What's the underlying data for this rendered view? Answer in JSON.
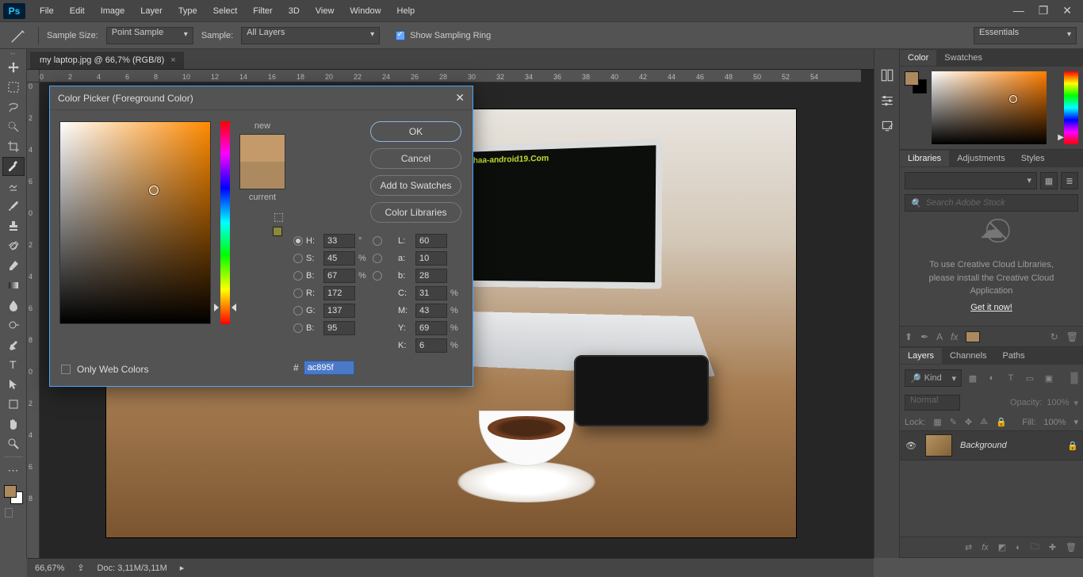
{
  "menu": [
    "File",
    "Edit",
    "Image",
    "Layer",
    "Type",
    "Select",
    "Filter",
    "3D",
    "View",
    "Window",
    "Help"
  ],
  "options": {
    "sample_size_label": "Sample Size:",
    "sample_size_value": "Point Sample",
    "sample_label": "Sample:",
    "sample_value": "All Layers",
    "show_ring": "Show Sampling Ring",
    "workspace": "Essentials"
  },
  "document": {
    "tab_title": "my laptop.jpg @ 66,7% (RGB/8)",
    "watermark": "kuyhaa-android19"
  },
  "ruler_h": [
    "0",
    "2",
    "4",
    "6",
    "8",
    "10",
    "12",
    "14",
    "16",
    "18",
    "20",
    "22",
    "24",
    "26",
    "28",
    "30",
    "32",
    "34",
    "36",
    "38",
    "40",
    "42",
    "44",
    "46",
    "48",
    "50",
    "52",
    "54"
  ],
  "ruler_v": [
    "0",
    "2",
    "4",
    "6",
    "0",
    "2",
    "4",
    "6",
    "8",
    "0",
    "2",
    "4",
    "6",
    "8"
  ],
  "status": {
    "zoom": "66,67%",
    "doc": "Doc: 3,11M/3,11M"
  },
  "panels": {
    "color_tabs": [
      "Color",
      "Swatches"
    ],
    "mid_tabs": [
      "Libraries",
      "Adjustments",
      "Styles"
    ],
    "lib_search": "Search Adobe Stock",
    "lib_msg": "To use Creative Cloud Libraries, please install the Creative Cloud Application",
    "lib_link": "Get it now!",
    "layer_tabs": [
      "Layers",
      "Channels",
      "Paths"
    ],
    "kind": "Kind",
    "blend": "Normal",
    "opacity_lbl": "Opacity:",
    "opacity_val": "100%",
    "lock_lbl": "Lock:",
    "fill_lbl": "Fill:",
    "fill_val": "100%",
    "layer_name": "Background"
  },
  "picker": {
    "title": "Color Picker (Foreground Color)",
    "new_lbl": "new",
    "current_lbl": "current",
    "ok": "OK",
    "cancel": "Cancel",
    "add": "Add to Swatches",
    "libraries": "Color Libraries",
    "only_web": "Only Web Colors",
    "hex": "ac895f",
    "H": "33",
    "S": "45",
    "Bv": "67",
    "L": "60",
    "a": "10",
    "b": "28",
    "R": "172",
    "G": "137",
    "Bb": "95",
    "C": "31",
    "M": "43",
    "Y": "69",
    "K": "6"
  }
}
